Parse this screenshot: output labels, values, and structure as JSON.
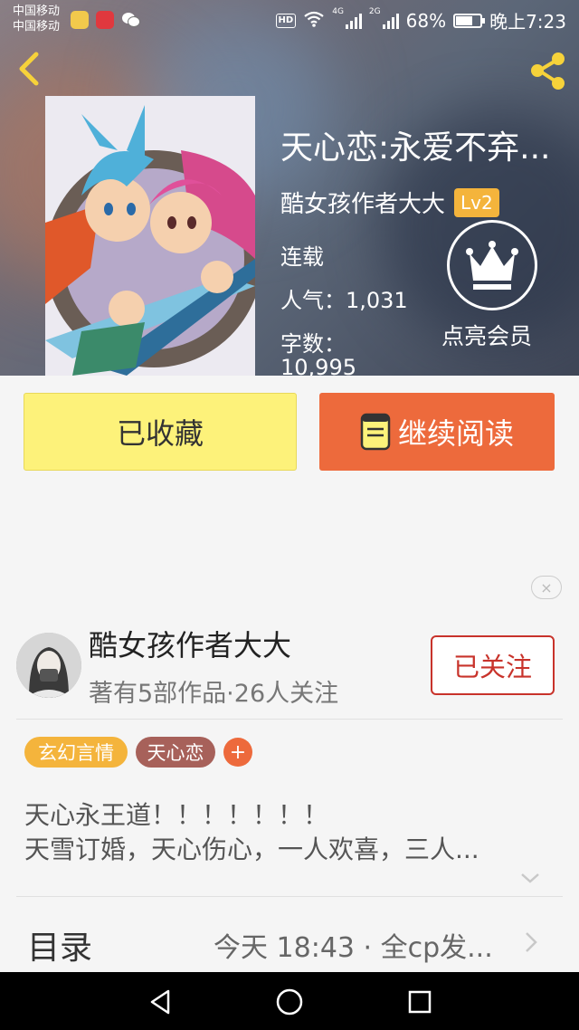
{
  "status_bar": {
    "carrier_1": "中国移动",
    "carrier_2": "中国移动",
    "hd": "HD",
    "net_1": "4G",
    "net_2": "2G",
    "battery_percent": "68%",
    "battery_level": 0.68,
    "time": "晚上7:23"
  },
  "book": {
    "title": "天心恋:永爱不弃...",
    "author": "酷女孩作者大大",
    "level": "Lv2",
    "status": "连载",
    "popularity": "人气：1,031",
    "word_count_label": "字数：",
    "word_count_value": "10,995"
  },
  "membership": {
    "label": "点亮会员"
  },
  "actions": {
    "favorite_label": "已收藏",
    "read_label": "继续阅读"
  },
  "author_card": {
    "name": "酷女孩作者大大",
    "stats": "著有5部作品·26人关注",
    "follow_label": "已关注"
  },
  "tags": [
    {
      "label": "玄幻言情"
    },
    {
      "label": "天心恋"
    },
    {
      "label": "+"
    }
  ],
  "description": {
    "line_1": "天心永王道！！！！！！！",
    "line_2": "天雪订婚，天心伤心，一人欢喜，三人..."
  },
  "catalog": {
    "title": "目录",
    "update": "今天 18:43 · 全cp发..."
  },
  "close_ad": "×",
  "colors": {
    "favorite_bg": "#fdf27a",
    "read_bg": "#ed6a3c",
    "follow_accent": "#c8332b",
    "level_badge": "#f4b43c",
    "tag_genre": "#f4b43c",
    "tag_topic": "#a7615a",
    "icon_yellow": "#f6d23a"
  }
}
